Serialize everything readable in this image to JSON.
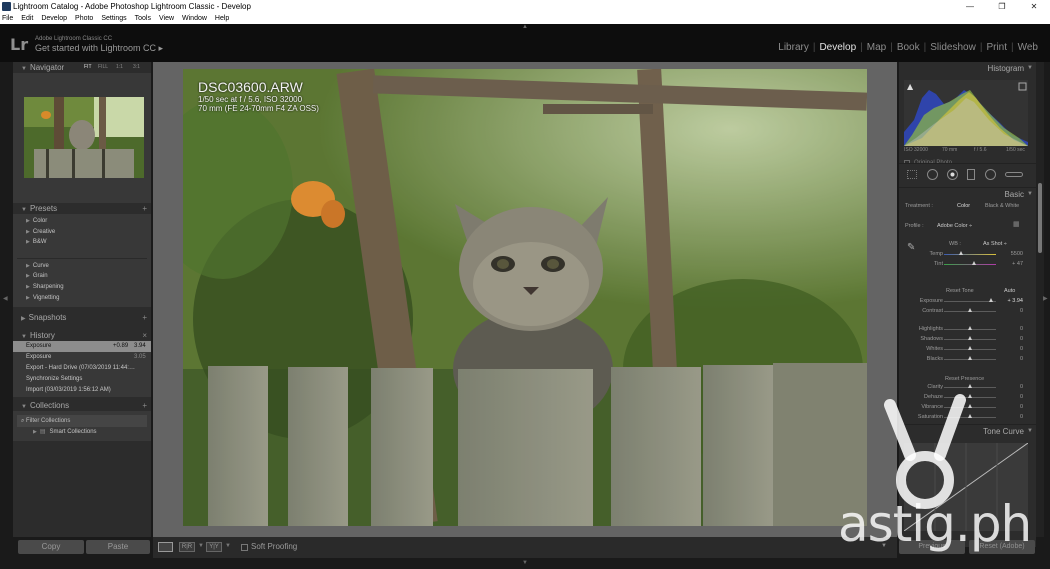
{
  "window": {
    "title": "Lightroom Catalog - Adobe Photoshop Lightroom Classic - Develop",
    "controls": [
      "—",
      "❐",
      "✕"
    ]
  },
  "menu": [
    "File",
    "Edit",
    "Develop",
    "Photo",
    "Settings",
    "Tools",
    "View",
    "Window",
    "Help"
  ],
  "header": {
    "logo": "Lr",
    "catalog_small": "Adobe Lightroom Classic CC",
    "catalog_main": "Get started with Lightroom CC ▸",
    "modules": [
      "Library",
      "Develop",
      "Map",
      "Book",
      "Slideshow",
      "Print",
      "Web"
    ],
    "active_module": "Develop"
  },
  "left_panel": {
    "navigator": {
      "title": "Navigator",
      "zoom_options": [
        "FIT",
        "FILL",
        "1:1",
        "3:1"
      ]
    },
    "presets": {
      "title": "Presets",
      "group1": [
        "Color",
        "Creative",
        "B&W"
      ],
      "group2": [
        "Curve",
        "Grain",
        "Sharpening",
        "Vignetting"
      ]
    },
    "snapshots": {
      "title": "Snapshots"
    },
    "history": {
      "title": "History",
      "close": "×",
      "items": [
        {
          "label": "Exposure",
          "a": "+0.89",
          "b": "3.94"
        },
        {
          "label": "Exposure",
          "a": "",
          "b": "3.05"
        },
        {
          "label": "Export - Hard Drive (07/03/2019 11:44:…",
          "a": "",
          "b": ""
        },
        {
          "label": "Synchronize Settings",
          "a": "",
          "b": ""
        },
        {
          "label": "Import (03/03/2019 1:56:12 AM)",
          "a": "",
          "b": ""
        }
      ]
    },
    "collections": {
      "title": "Collections",
      "filter": "Filter Collections",
      "item": "Smart Collections"
    },
    "copy_button": "Copy",
    "paste_button": "Paste"
  },
  "photo_info": {
    "filename": "DSC03600.ARW",
    "exposure": "1/50 sec at f / 5.6, ISO 32000",
    "lens": "70 mm (FE 24-70mm F4 ZA OSS)"
  },
  "toolbar": {
    "soft_proofing": "Soft Proofing"
  },
  "right_panel": {
    "histogram": {
      "title": "Histogram",
      "info": [
        "ISO 32000",
        "70 mm",
        "f / 5.6",
        "1/50 sec"
      ],
      "original_photo": "Original Photo"
    },
    "basic": {
      "title": "Basic",
      "treatment_label": "Treatment :",
      "treatment_color": "Color",
      "treatment_bw": "Black & White",
      "profile_label": "Profile :",
      "profile_value": "Adobe Color ÷",
      "wb_label": "WB :",
      "wb_value": "As Shot ÷",
      "tone_label": "Reset Tone",
      "tone_auto": "Auto",
      "presence_label": "Reset Presence",
      "sliders": [
        {
          "label": "Temp",
          "value": "5500",
          "pos": 0.33
        },
        {
          "label": "Tint",
          "value": "+ 47",
          "pos": 0.58
        },
        {
          "label": "Exposure",
          "value": "+ 3.94",
          "pos": 0.92
        },
        {
          "label": "Contrast",
          "value": "0",
          "pos": 0.5
        },
        {
          "label": "Highlights",
          "value": "0",
          "pos": 0.5
        },
        {
          "label": "Shadows",
          "value": "0",
          "pos": 0.5
        },
        {
          "label": "Whites",
          "value": "0",
          "pos": 0.5
        },
        {
          "label": "Blacks",
          "value": "0",
          "pos": 0.5
        },
        {
          "label": "Clarity",
          "value": "0",
          "pos": 0.5
        },
        {
          "label": "Dehaze",
          "value": "0",
          "pos": 0.5
        },
        {
          "label": "Vibrance",
          "value": "0",
          "pos": 0.5
        },
        {
          "label": "Saturation",
          "value": "0",
          "pos": 0.5
        }
      ]
    },
    "tone_curve": {
      "title": "Tone Curve"
    },
    "previous_button": "Previous",
    "reset_button": "Reset (Adobe)"
  },
  "watermark": "astig.ph"
}
